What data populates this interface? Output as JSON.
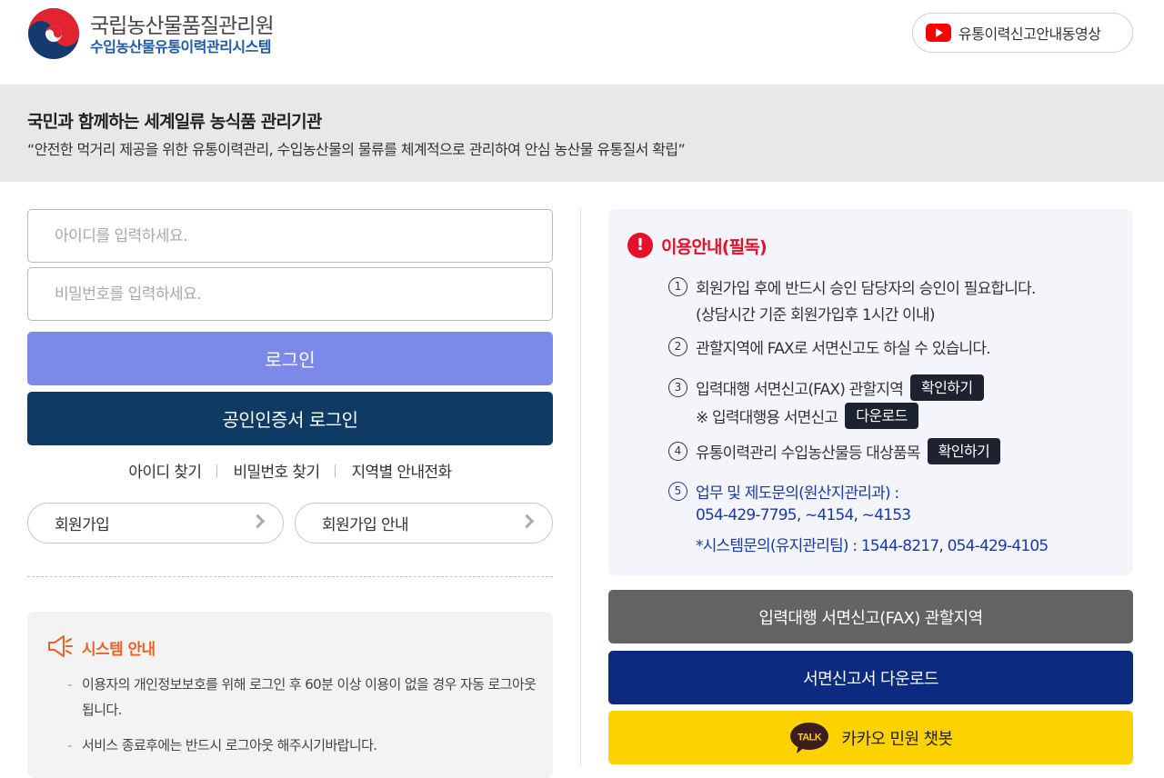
{
  "header": {
    "org_name": "국립농산물품질관리원",
    "system_name": "수입농산물유통이력관리시스템",
    "video_button_label": "유통이력신고안내동영상",
    "video_icon": "youtube-icon"
  },
  "banner": {
    "title": "국민과 함께하는 세계일류 농식품 관리기관",
    "subtitle": "“안전한 먹거리 제공을 위한 유통이력관리, 수입농산물의 물류를 체계적으로 관리하여 안심 농산물 유통질서 확립”"
  },
  "login": {
    "id_placeholder": "아이디를 입력하세요.",
    "pw_placeholder": "비밀번호를 입력하세요.",
    "login_label": "로그인",
    "cert_login_label": "공인인증서 로그인",
    "links": [
      "아이디 찾기",
      "비밀번호 찾기",
      "지역별 안내전화"
    ],
    "join_label": "회원가입",
    "join_guide_label": "회원가입 안내"
  },
  "system_notice": {
    "title": "시스템 안내",
    "items": [
      "이용자의 개인정보보호를 위해 로그인 후 60분 이상 이용이 없을 경우 자동 로그아웃 됩니다.",
      "서비스 종료후에는 반드시 로그아웃 해주시기바랍니다."
    ]
  },
  "usage_notice": {
    "title": "이용안내(필독)",
    "item1": "회원가입 후에 반드시 승인 담당자의 승인이 필요합니다.",
    "item1_sub": "(상담시간 기준 회원가입후 1시간 이내)",
    "item2": "관할지역에 FAX로 서면신고도 하실 수 있습니다.",
    "item3": "입력대행 서면신고(FAX) 관할지역",
    "item3_button": "확인하기",
    "item3_sub": "※ 입력대행용 서면신고",
    "item3_sub_button": "다운로드",
    "item4": "유통이력관리 수입농산물등 대상품목",
    "item4_button": "확인하기",
    "item5": "업무 및 제도문의(원산지관리과) :",
    "item5_line2": "054-429-7795, ~4154, ~4153",
    "item5_line3": "*시스템문의(유지관리팀) : 1544-8217,  054-429-4105",
    "numbers": [
      "1",
      "2",
      "3",
      "4",
      "5"
    ]
  },
  "action_buttons": {
    "fax_label": "입력대행 서면신고(FAX) 관할지역",
    "download_label": "서면신고서 다운로드",
    "kakao_label": "카카오 민원 챗봇",
    "kakao_icon_text": "TALK"
  },
  "colors": {
    "login_button": "#7b89e8",
    "cert_button": "#0e3a63",
    "notice_red": "#e5112b",
    "system_orange": "#e8632a",
    "link_blue": "#1a3aa8",
    "fax_button": "#636363",
    "download_button": "#0b2a80",
    "kakao_yellow": "#fcd300"
  }
}
